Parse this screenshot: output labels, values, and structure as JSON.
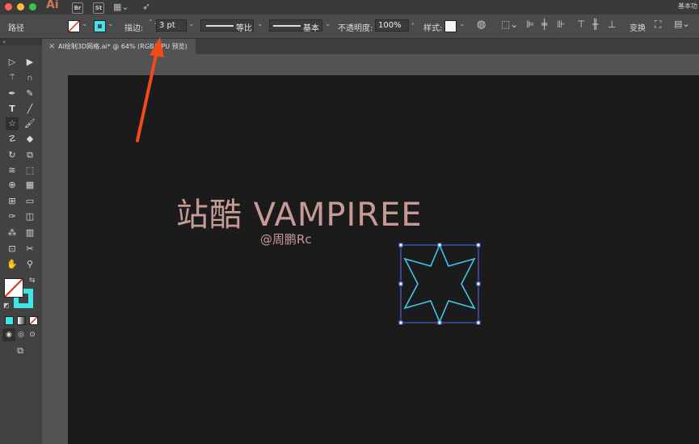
{
  "titlebar": {
    "app_logo": "Ai",
    "bridge": "Br",
    "stock": "St",
    "workspace": "基本功"
  },
  "controlbar": {
    "selection_type": "路径",
    "stroke_label": "描边:",
    "stroke_weight": "3 pt",
    "profile_label": "等比",
    "brush_label": "基本",
    "opacity_label": "不透明度:",
    "opacity_value": "100%",
    "style_label": "样式:",
    "transform_label": "变换"
  },
  "document_tab": {
    "close": "×",
    "title": "AI绘制3D网格.ai* @ 64% (RGB/GPU 预览)"
  },
  "artboard": {
    "title": "站酷 VAMPIREE",
    "subtitle": "@周鹏Rc"
  },
  "colors": {
    "stroke_color": "#3ec6e8",
    "fill": "none",
    "selection_color": "#4a6df0",
    "annotation_arrow": "#f24a1a",
    "text_color": "#c79b95"
  },
  "shape": {
    "type": "8-point star",
    "selected": true
  }
}
